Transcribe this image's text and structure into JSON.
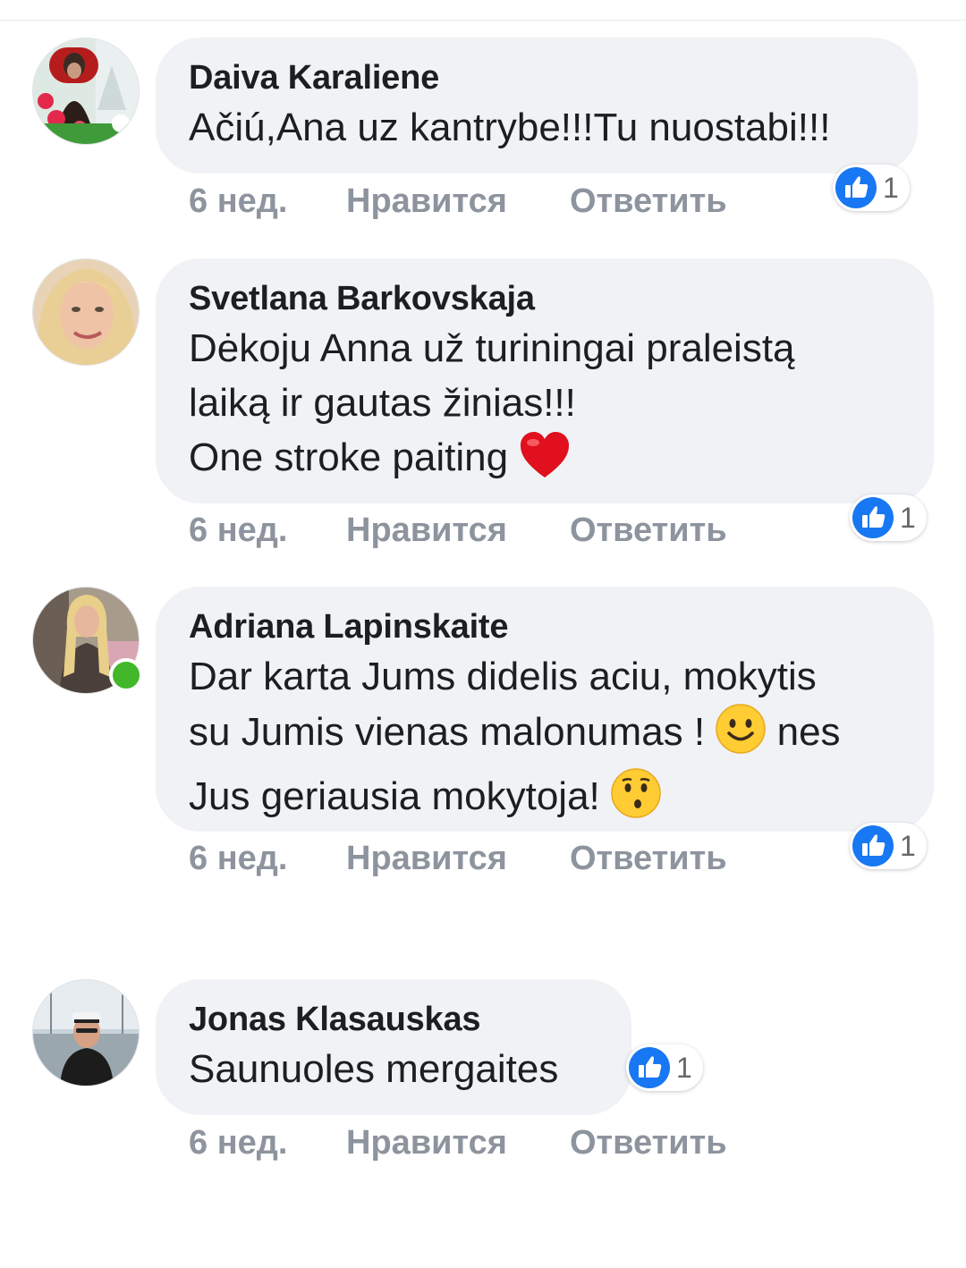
{
  "comments": [
    {
      "author": "Daiva Karaliene",
      "lines": [
        "Ačiú,Ana uz kantrybe!!!Tu nuostabi!!!"
      ],
      "time": "6 нед.",
      "like_label": "Нравится",
      "reply_label": "Ответить",
      "reactions": "1",
      "online": false
    },
    {
      "author": "Svetlana Barkovskaja",
      "lines": [
        "Dėkoju Anna už turiningai praleistą",
        "laiką ir gautas žinias!!!",
        "One stroke paiting"
      ],
      "time": "6 нед.",
      "like_label": "Нравится",
      "reply_label": "Ответить",
      "reactions": "1",
      "online": false
    },
    {
      "author": "Adriana Lapinskaite",
      "lines": [
        "Dar karta Jums didelis aciu, mokytis",
        "su Jumis vienas malonumas !",
        "nes",
        "Jus geriausia mokytoja!"
      ],
      "time": "6 нед.",
      "like_label": "Нравится",
      "reply_label": "Ответить",
      "reactions": "1",
      "online": true
    },
    {
      "author": "Jonas Klasauskas",
      "lines": [
        "Saunuoles mergaites"
      ],
      "time": "6 нед.",
      "like_label": "Нравится",
      "reply_label": "Ответить",
      "reactions": "1",
      "online": false
    }
  ],
  "emojis": [
    "heart-emoji",
    "smiling-face-emoji",
    "kissing-face-emoji"
  ],
  "colors": {
    "bubble": "#f0f2f5",
    "text": "#1c1e21",
    "meta": "#8d949e",
    "like_blue": "#1877f2",
    "online_green": "#42b72a"
  }
}
